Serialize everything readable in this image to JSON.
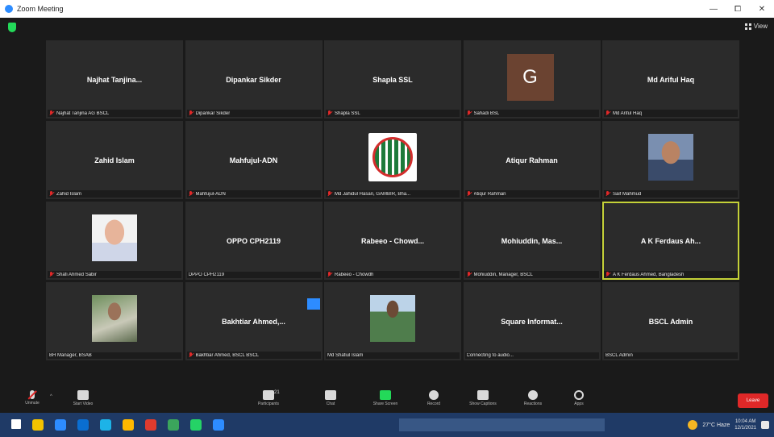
{
  "titlebar": {
    "title": "Zoom Meeting",
    "minimize": "—",
    "maximize": "⧠",
    "close": "✕"
  },
  "header": {
    "view_label": "View"
  },
  "tiles": [
    {
      "display": "Najhat Tanjina...",
      "label": "Najhat Tanjina AG BSCL",
      "muted": true
    },
    {
      "display": "Dipankar Sikder",
      "label": "Dipankar Sikder",
      "muted": true
    },
    {
      "display": "Shapla SSL",
      "label": "Shapla SSL",
      "muted": true
    },
    {
      "display": "",
      "label": "Sahadi BSL",
      "muted": true,
      "letter": "G"
    },
    {
      "display": "Md Ariful Haq",
      "label": "Md Ariful Haq",
      "muted": true
    },
    {
      "display": "Zahid Islam",
      "label": "Zahid Islam",
      "muted": true
    },
    {
      "display": "Mahfujul-ADN",
      "label": "Mahfujul-ADN",
      "muted": true
    },
    {
      "display": "",
      "label": "Md Jahidul Hasan, GAMBIR, Bha...",
      "muted": true,
      "image": "logo"
    },
    {
      "display": "Atiqur Rahman",
      "label": "Atiqur Rahman",
      "muted": true
    },
    {
      "display": "",
      "label": "Saif Mahmud",
      "muted": true,
      "image": "face2"
    },
    {
      "display": "",
      "label": "Shafi Ahmed Sabir",
      "muted": true,
      "image": "face"
    },
    {
      "display": "OPPO CPH2119",
      "label": "OPPO CPH2119",
      "muted": false
    },
    {
      "display": "Rabeeo - Chowd...",
      "label": "Rabeeo - Chowdh",
      "muted": true
    },
    {
      "display": "Mohiuddin, Mas...",
      "label": "Mohiuddin, Manager, BSCL",
      "muted": true
    },
    {
      "display": "A K Ferdaus Ah...",
      "label": "A K Ferdaus Ahmed, Bangladesh",
      "muted": true,
      "active": true
    },
    {
      "display": "",
      "label": "BH Manager, BSAB",
      "muted": false,
      "image": "outdoor"
    },
    {
      "display": "Bakhtiar Ahmed,...",
      "label": "Bakhtiar Ahmed, BSCL BSCL",
      "muted": true
    },
    {
      "display": "",
      "label": "Md Shafiul Islam",
      "muted": false,
      "image": "field"
    },
    {
      "display": "Square Informat...",
      "label": "Connecting to audio...",
      "muted": false
    },
    {
      "display": "BSCL Admin",
      "label": "BSCL Admin",
      "muted": false
    }
  ],
  "controls": {
    "unmute": "Unmute",
    "start_video": "Start Video",
    "participants": "Participants",
    "participants_count": "21",
    "chat": "Chat",
    "share_screen": "Share Screen",
    "record": "Record",
    "show_captions": "Show Captions",
    "reactions": "Reactions",
    "apps": "Apps",
    "leave": "Leave"
  },
  "taskbar": {
    "weather": "27°C Haze",
    "time": "10:04 AM",
    "date": "12/1/2021",
    "app_colors": [
      "#ffffff",
      "#f2c200",
      "#2d8cff",
      "#0a6ed1",
      "#1db3e7",
      "#ffb900",
      "#e03b2e",
      "#3ba55c",
      "#25d366",
      "#2d8cff"
    ]
  }
}
